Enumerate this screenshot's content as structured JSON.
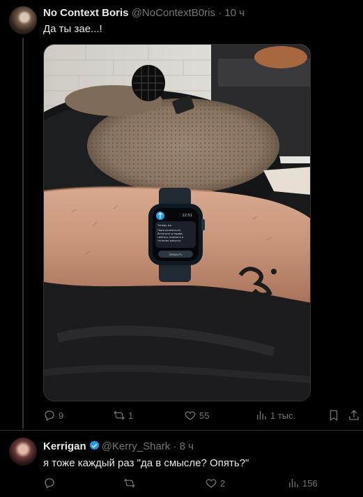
{
  "tweet": {
    "author_name": "No Context Boris",
    "handle": "@NoContextB0ris",
    "separator": "·",
    "time": "10 ч",
    "text": "Да ты зае...!",
    "media": {
      "watch_time": "22:51",
      "watch_header": "Теперь же",
      "watch_message": "Пора размяться! Встаньте и подвигайтесь немного в течение минуты.",
      "watch_button": "Закрыть"
    },
    "stats": {
      "replies": "9",
      "reposts": "1",
      "likes": "55",
      "views": "1 тыс."
    }
  },
  "reply": {
    "author_name": "Kerrigan",
    "handle": "@Kerry_Shark",
    "separator": "·",
    "time": "8 ч",
    "text": "я тоже каждый раз \"да в смысле? Опять?\"",
    "stats": {
      "replies": "",
      "reposts": "",
      "likes": "2",
      "views": "156"
    }
  },
  "colors": {
    "background": "#000000",
    "text": "#e7e9ea",
    "muted": "#71767b",
    "verified": "#1d9bf0",
    "border": "#2f3336"
  }
}
